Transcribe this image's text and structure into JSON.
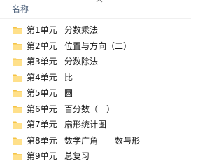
{
  "header": {
    "name_label": "名称",
    "sort_icon": "chevron-up-icon"
  },
  "colors": {
    "folder_body": "#ffe08a",
    "folder_tab": "#f5c345",
    "header_text": "#4c607a",
    "row_hover": "#e5f3ff"
  },
  "items": [
    {
      "unit": "第1单元",
      "title": "分数乘法",
      "icon": "folder-icon"
    },
    {
      "unit": "第2单元",
      "title": "位置与方向（二）",
      "icon": "folder-icon"
    },
    {
      "unit": "第3单元",
      "title": "分数除法",
      "icon": "folder-icon"
    },
    {
      "unit": "第4单元",
      "title": "比",
      "icon": "folder-icon"
    },
    {
      "unit": "第5单元",
      "title": "圆",
      "icon": "folder-icon"
    },
    {
      "unit": "第6单元",
      "title": "百分数（一）",
      "icon": "folder-icon"
    },
    {
      "unit": "第7单元",
      "title": "扇形统计图",
      "icon": "folder-icon"
    },
    {
      "unit": "第8单元",
      "title": "数学广角——数与形",
      "icon": "folder-icon"
    },
    {
      "unit": "第9单元",
      "title": "总复习",
      "icon": "folder-icon"
    }
  ]
}
